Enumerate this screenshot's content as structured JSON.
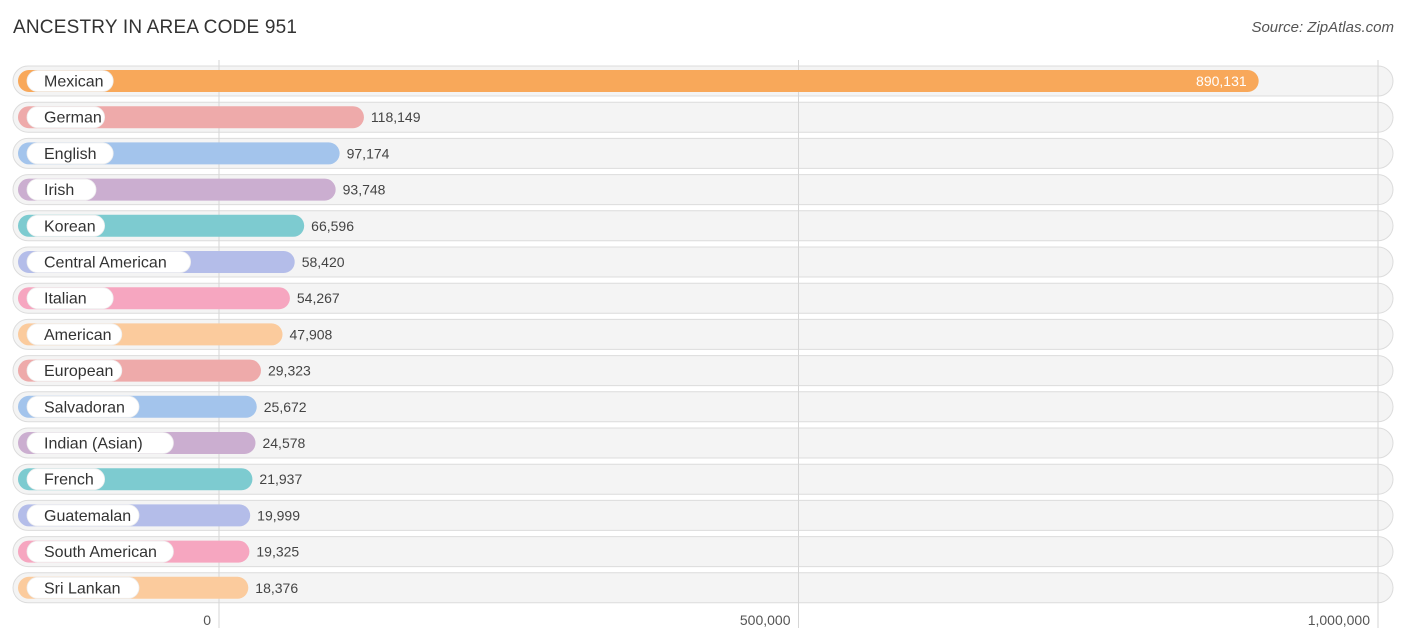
{
  "header": {
    "title": "ANCESTRY IN AREA CODE 951",
    "source": "Source: ZipAtlas.com"
  },
  "chart_data": {
    "type": "bar",
    "orientation": "horizontal",
    "title": "ANCESTRY IN AREA CODE 951",
    "xlabel": "",
    "ylabel": "",
    "xlim": [
      0,
      1000000
    ],
    "xticks": [
      0,
      500000,
      1000000
    ],
    "xtick_labels": [
      "0",
      "500,000",
      "1,000,000"
    ],
    "grid": true,
    "categories": [
      "Mexican",
      "German",
      "English",
      "Irish",
      "Korean",
      "Central American",
      "Italian",
      "American",
      "European",
      "Salvadoran",
      "Indian (Asian)",
      "French",
      "Guatemalan",
      "South American",
      "Sri Lankan"
    ],
    "values": [
      890131,
      118149,
      97174,
      93748,
      66596,
      58420,
      54267,
      47908,
      29323,
      25672,
      24578,
      21937,
      19999,
      19325,
      18376
    ],
    "value_labels": [
      "890,131",
      "118,149",
      "97,174",
      "93,748",
      "66,596",
      "58,420",
      "54,267",
      "47,908",
      "29,323",
      "25,672",
      "24,578",
      "21,937",
      "19,999",
      "19,325",
      "18,376"
    ],
    "colors": [
      "#f8a85a",
      "#eeaaaa",
      "#a3c4ec",
      "#cbaed0",
      "#7dcbd0",
      "#b4bde9",
      "#f6a6c0",
      "#fbcb9d",
      "#eeaaaa",
      "#a3c4ec",
      "#cbaed0",
      "#7dcbd0",
      "#b4bde9",
      "#f6a6c0",
      "#fbcb9d"
    ]
  }
}
